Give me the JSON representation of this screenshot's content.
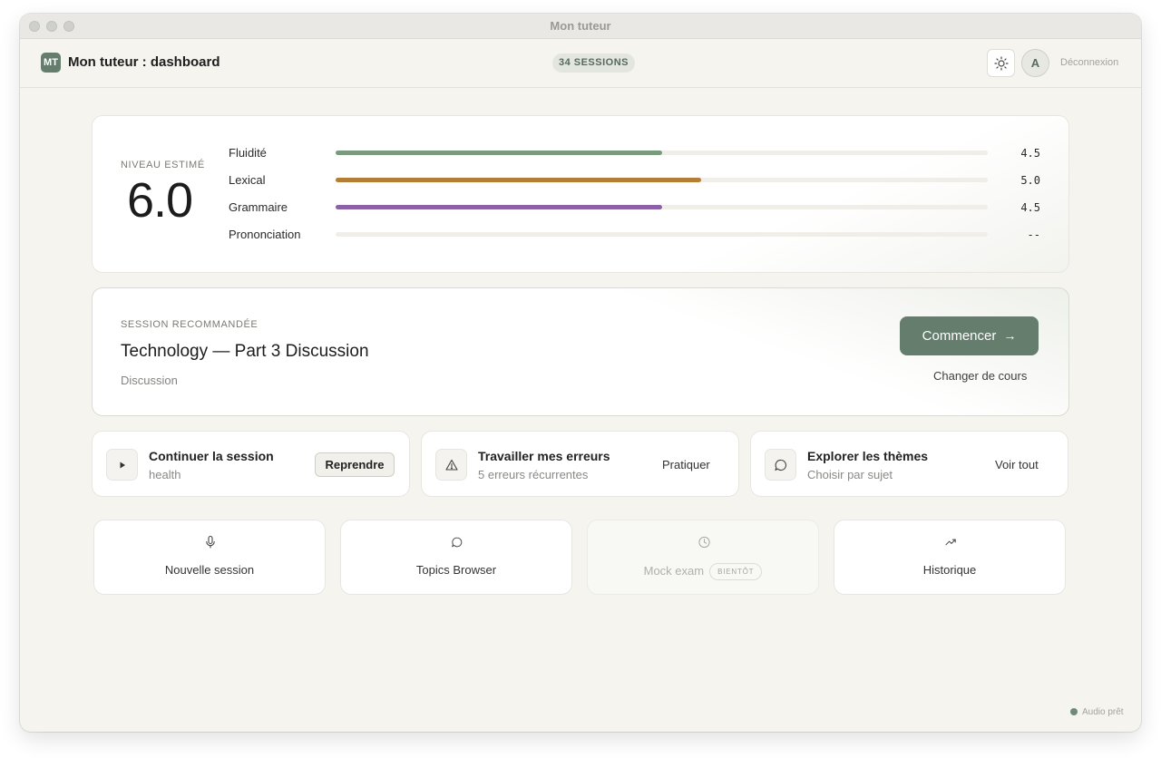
{
  "window": {
    "title": "Mon tuteur"
  },
  "header": {
    "logo": "MT",
    "title": "Mon tuteur : dashboard",
    "sessions_badge": "34 SESSIONS",
    "avatar_initial": "A",
    "logout": "Déconnexion"
  },
  "level": {
    "label": "NIVEAU ESTIMÉ",
    "value": "6.0",
    "metrics": [
      {
        "label": "Fluidité",
        "value": "4.5",
        "fill": 0.5,
        "color": "#7a9a7d"
      },
      {
        "label": "Lexical",
        "value": "5.0",
        "fill": 0.56,
        "color": "#b57d35"
      },
      {
        "label": "Grammaire",
        "value": "4.5",
        "fill": 0.5,
        "color": "#8c61a6"
      },
      {
        "label": "Prononciation",
        "value": "--",
        "fill": 0,
        "color": "#cfcec8"
      }
    ]
  },
  "recommended": {
    "eyebrow": "SESSION RECOMMANDÉE",
    "title": "Technology — Part 3 Discussion",
    "subtitle": "Discussion",
    "start_label": "Commencer",
    "change_label": "Changer de cours"
  },
  "actions": [
    {
      "title": "Continuer la session",
      "subtitle": "health",
      "button": "Reprendre",
      "icon": "play-icon"
    },
    {
      "title": "Travailler mes erreurs",
      "subtitle": "5 erreurs récurrentes",
      "button": "Pratiquer",
      "icon": "warning-icon"
    },
    {
      "title": "Explorer les thèmes",
      "subtitle": "Choisir par sujet",
      "button": "Voir tout",
      "icon": "chat-bubble-icon"
    }
  ],
  "tiles": [
    {
      "label": "Nouvelle session",
      "icon": "microphone-icon"
    },
    {
      "label": "Topics Browser",
      "icon": "chat-bubble-icon"
    },
    {
      "label": "Mock exam",
      "badge": "BIENTÔT",
      "icon": "clock-icon"
    },
    {
      "label": "Historique",
      "icon": "trending-up-icon"
    }
  ],
  "status": {
    "audio": "Audio prêt"
  }
}
